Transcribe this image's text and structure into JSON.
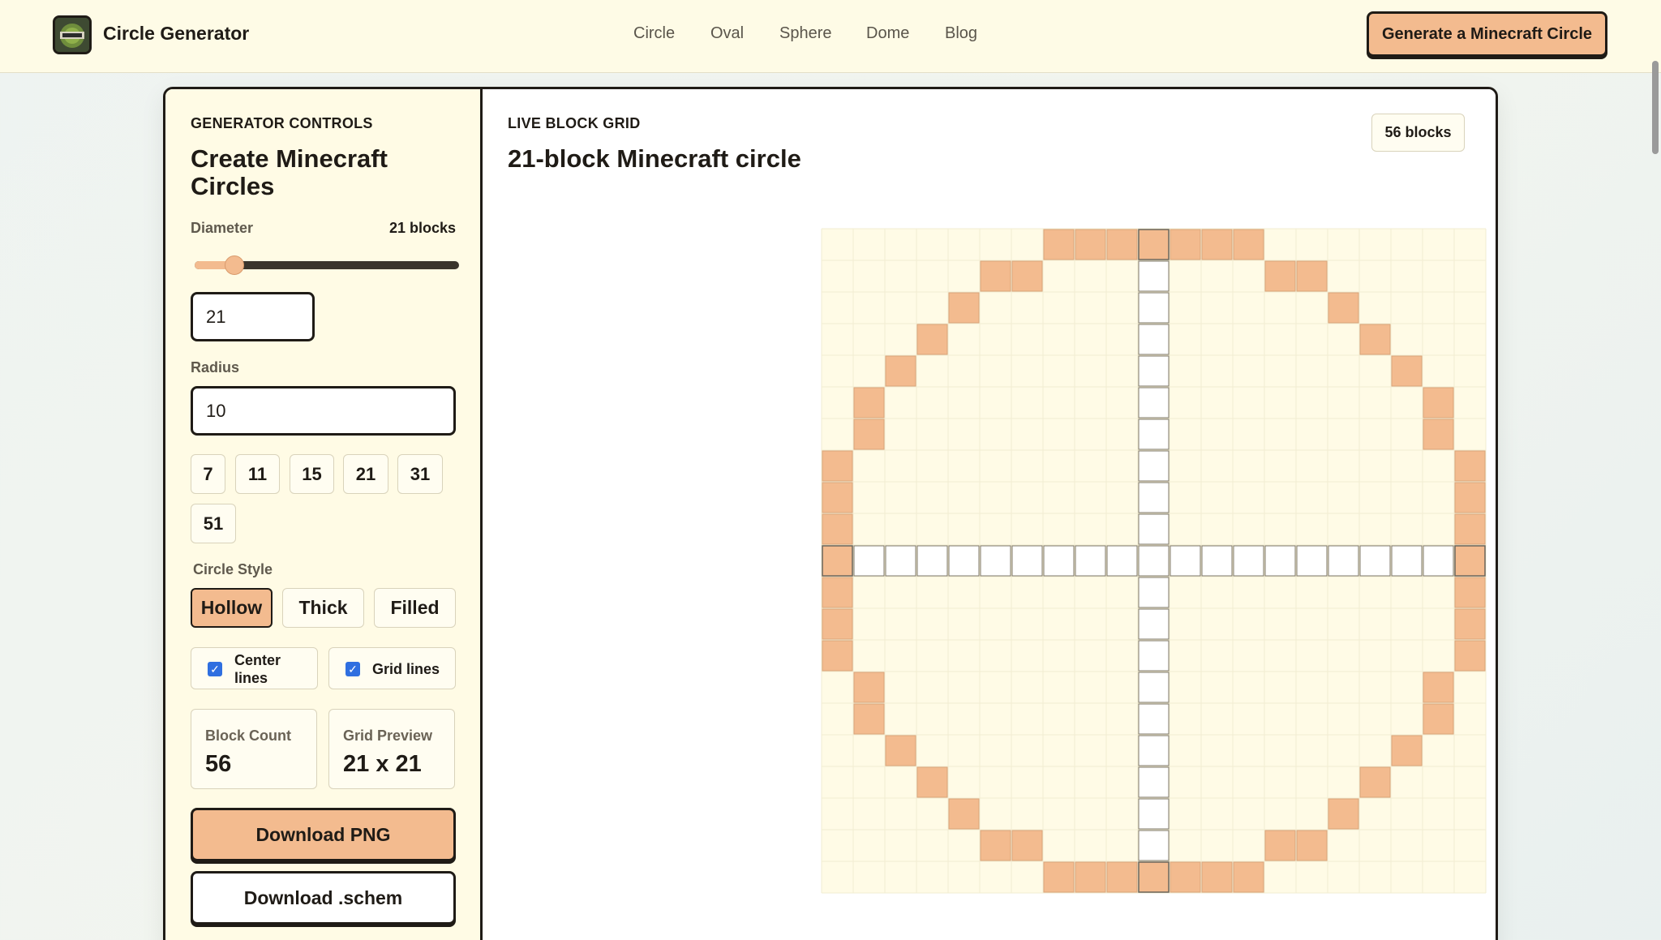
{
  "header": {
    "brand": "Circle Generator",
    "logo_icon": "minecraft-circle-logo-icon",
    "nav": [
      {
        "label": "Circle"
      },
      {
        "label": "Oval"
      },
      {
        "label": "Sphere"
      },
      {
        "label": "Dome"
      },
      {
        "label": "Blog"
      }
    ],
    "cta_label": "Generate a Minecraft Circle"
  },
  "controls": {
    "eyebrow": "GENERATOR CONTROLS",
    "title": "Create Minecraft Circles",
    "diameter_label": "Diameter",
    "diameter_value_text": "21 blocks",
    "diameter_slider": {
      "min": 1,
      "max": 201,
      "value": 21
    },
    "diameter_input": "21",
    "radius_label": "Radius",
    "radius_input": "10",
    "presets": [
      "7",
      "11",
      "15",
      "21",
      "31",
      "51"
    ],
    "style_label": "Circle Style",
    "styles": [
      {
        "label": "Hollow",
        "active": true
      },
      {
        "label": "Thick",
        "active": false
      },
      {
        "label": "Filled",
        "active": false
      }
    ],
    "center_lines": {
      "label": "Center lines",
      "checked": true
    },
    "grid_lines": {
      "label": "Grid lines",
      "checked": true
    },
    "block_count": {
      "label": "Block Count",
      "value": "56"
    },
    "grid_preview": {
      "label": "Grid Preview",
      "value": "21 x 21"
    },
    "download_png": "Download PNG",
    "download_schem": "Download .schem"
  },
  "grid": {
    "eyebrow": "LIVE BLOCK GRID",
    "title": "21-block Minecraft circle",
    "badge": "56 blocks",
    "size": 21,
    "style": "hollow",
    "block_color": "#f3bb8f",
    "background_color": "#fffbe6"
  },
  "colors": {
    "accent": "#f3bb8f",
    "ink": "#1f1b16",
    "panel": "#fffbe5",
    "checkbox": "#2f6fe0"
  }
}
